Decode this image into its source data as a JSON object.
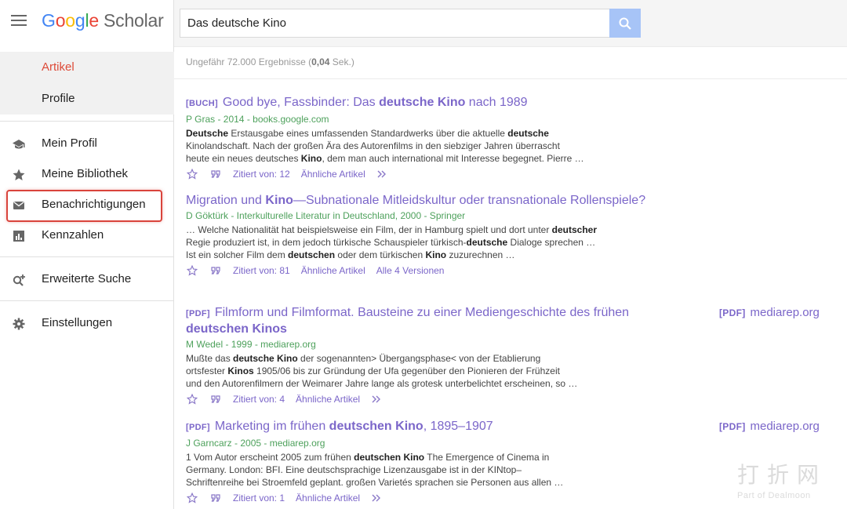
{
  "brand": {
    "google": [
      "G",
      "o",
      "o",
      "g",
      "l",
      "e"
    ],
    "scholar": "Scholar"
  },
  "sidebar": {
    "filters": [
      {
        "label": "Artikel"
      },
      {
        "label": "Profile"
      }
    ],
    "nav": [
      {
        "label": "Mein Profil",
        "icon": "graduation-cap-icon"
      },
      {
        "label": "Meine Bibliothek",
        "icon": "star-icon"
      },
      {
        "label": "Benachrichtigungen",
        "icon": "envelope-icon"
      },
      {
        "label": "Kennzahlen",
        "icon": "chart-icon"
      },
      {
        "label": "Erweiterte Suche",
        "icon": "advanced-search-icon"
      },
      {
        "label": "Einstellungen",
        "icon": "gear-icon"
      }
    ]
  },
  "search": {
    "value": "Das deutsche Kino"
  },
  "stats": {
    "prefix": "Ungefähr 72.000 Ergebnisse (",
    "time": "0,04",
    "suffix": " Sek.)"
  },
  "results": [
    {
      "tag": "[BUCH]",
      "title_parts": [
        "Good bye, Fassbinder: Das ",
        "deutsche Kino",
        " nach 1989"
      ],
      "meta": "P Gras - 2014 - books.google.com",
      "snippet_lines": [
        [
          "",
          "Deutsche",
          " Erstausgabe eines umfassenden Standardwerks über die aktuelle ",
          "deutsche",
          ""
        ],
        [
          "Kinolandschaft. Nach der großen Ära des Autorenfilms in den siebziger Jahren überrascht",
          "",
          "",
          "",
          ""
        ],
        [
          "heute ein neues deutsches ",
          "Kino",
          ", dem man auch international mit Interesse begegnet. Pierre …",
          "",
          ""
        ]
      ],
      "cited": "Zitiert von: 12",
      "similar": "Ähnliche Artikel",
      "versions": ""
    },
    {
      "tag": "",
      "title_parts": [
        "Migration und ",
        "Kino",
        "—Subnationale Mitleidskultur oder transnationale Rollenspiele?"
      ],
      "meta": "D Göktürk - Interkulturelle Literatur in Deutschland, 2000 - Springer",
      "snippet_lines": [
        [
          "… Welche Nationalität hat beispielsweise ein Film, der in Hamburg spielt und dort unter ",
          "deutscher",
          "",
          "",
          ""
        ],
        [
          "Regie produziert ist, in dem jedoch türkische Schauspieler türkisch-",
          "deutsche",
          " Dialoge sprechen …",
          "",
          ""
        ],
        [
          "Ist ein solcher Film dem ",
          "deutschen",
          " oder dem türkischen ",
          "Kino",
          " zuzurechnen …"
        ]
      ],
      "cited": "Zitiert von: 81",
      "similar": "Ähnliche Artikel",
      "versions": "Alle 4 Versionen"
    },
    {
      "tag": "[PDF]",
      "title_parts": [
        "Filmform und Filmformat. Bausteine zu einer Mediengeschichte des frühen ",
        "deutschen Kinos",
        ""
      ],
      "meta": "M Wedel - 1999 - mediarep.org",
      "snippet_lines": [
        [
          "Mußte das ",
          "deutsche Kino",
          " der sogenannten> Übergangsphase< von der Etablierung",
          "",
          ""
        ],
        [
          "ortsfester ",
          "Kinos",
          " 1905/06 bis zur Gründung der Ufa gegenüber den Pionieren der Frühzeit",
          "",
          ""
        ],
        [
          "und den Autorenfilmern der Weimarer Jahre lange als grotesk unterbelichtet erscheinen, so …",
          "",
          "",
          "",
          ""
        ]
      ],
      "cited": "Zitiert von: 4",
      "similar": "Ähnliche Artikel",
      "versions": "",
      "side": {
        "tag": "[PDF]",
        "label": "mediarep.org"
      }
    },
    {
      "tag": "[PDF]",
      "title_parts": [
        "Marketing im frühen ",
        "deutschen Kino",
        ", 1895–1907"
      ],
      "meta": "J Garncarz - 2005 - mediarep.org",
      "snippet_lines": [
        [
          "1 Vom Autor erscheint 2005 zum frühen ",
          "deutschen Kino",
          " The Emergence of Cinema in",
          "",
          ""
        ],
        [
          "Germany. London: BFI. Eine deutschsprachige Lizenzausgabe ist in der KINtop–",
          "",
          "",
          "",
          ""
        ],
        [
          "Schriftenreihe bei Stroemfeld geplant. großen Varietés sprachen sie Personen aus allen …",
          "",
          "",
          "",
          ""
        ]
      ],
      "cited": "Zitiert von: 1",
      "similar": "Ähnliche Artikel",
      "versions": "",
      "side": {
        "tag": "[PDF]",
        "label": "mediarep.org"
      }
    }
  ],
  "watermark": {
    "big": "打折网",
    "small": "Part of Dealmoon"
  }
}
